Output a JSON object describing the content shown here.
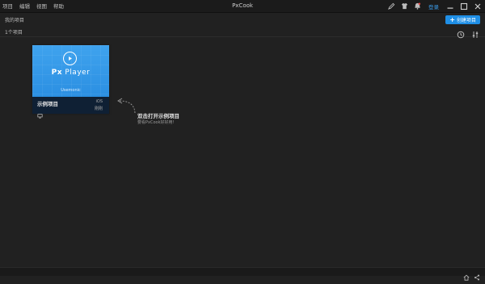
{
  "titlebar": {
    "menu": [
      "项目",
      "编辑",
      "视图",
      "帮助"
    ],
    "app_title": "PxCook",
    "login_label": "登录",
    "accent": "#1f8fe6"
  },
  "subbar": {
    "breadcrumb": "我的项目",
    "create_label": "创建项目"
  },
  "countbar": {
    "count_label": "1个项目"
  },
  "card": {
    "thumb_title_bold": "Px",
    "thumb_title_rest": " Player",
    "thumb_sub": "Usemonic",
    "name": "示例项目",
    "platform": "iOS",
    "time": "刚刚"
  },
  "hint": {
    "title": "双击打开示例项目",
    "subtitle": "要看PxCook好好用!"
  },
  "icons": {
    "titlebar": [
      "pen-icon",
      "shirt-icon",
      "bell-icon"
    ],
    "window": [
      "minimize-icon",
      "maximize-icon",
      "close-icon"
    ],
    "tools": [
      "history-icon",
      "filter-icon"
    ],
    "status": [
      "home-icon",
      "share-icon"
    ]
  }
}
